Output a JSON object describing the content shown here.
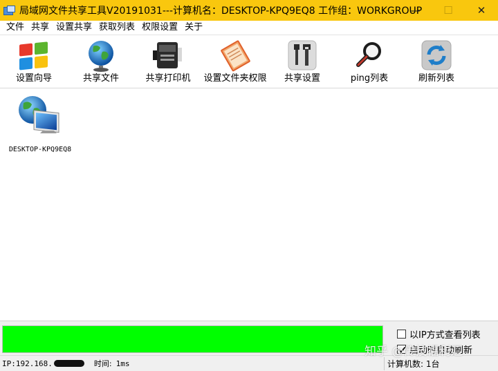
{
  "window": {
    "title": "局域网文件共享工具V20191031---计算机名：DESKTOP-KPQ9EQ8 工作组：WORKGROUP",
    "minimize": "—",
    "maximize": "☐",
    "close": "✕",
    "title_bar_color": "#f9c70e"
  },
  "menu": {
    "items": [
      "文件",
      "共享",
      "设置共享",
      "获取列表",
      "权限设置",
      "关于"
    ]
  },
  "toolbar": {
    "items": [
      {
        "label": "设置向导",
        "icon": "windows-logo-icon"
      },
      {
        "label": "共享文件",
        "icon": "globe-icon"
      },
      {
        "label": "共享打印机",
        "icon": "printer-icon"
      },
      {
        "label": "设置文件夹权限",
        "icon": "folder-book-icon"
      },
      {
        "label": "共享设置",
        "icon": "tools-icon"
      },
      {
        "label": "ping列表",
        "icon": "magnifier-icon"
      },
      {
        "label": "刷新列表",
        "icon": "refresh-icon"
      }
    ]
  },
  "computers": [
    {
      "name": "DESKTOP-KPQ9EQ8",
      "icon": "network-computer-icon"
    }
  ],
  "progress": {
    "value": 1.0,
    "color": "#00ff00"
  },
  "options": {
    "view_by_ip": {
      "label": "以IP方式查看列表",
      "checked": false
    },
    "auto_refresh": {
      "label": "启动时自动刷新",
      "checked": true
    }
  },
  "status": {
    "ip_label": "IP:192.168.",
    "time_label": "时间:",
    "time_value": "1ms",
    "count": "计算机数: 1台"
  },
  "watermark": "知乎 @传技福利汇"
}
